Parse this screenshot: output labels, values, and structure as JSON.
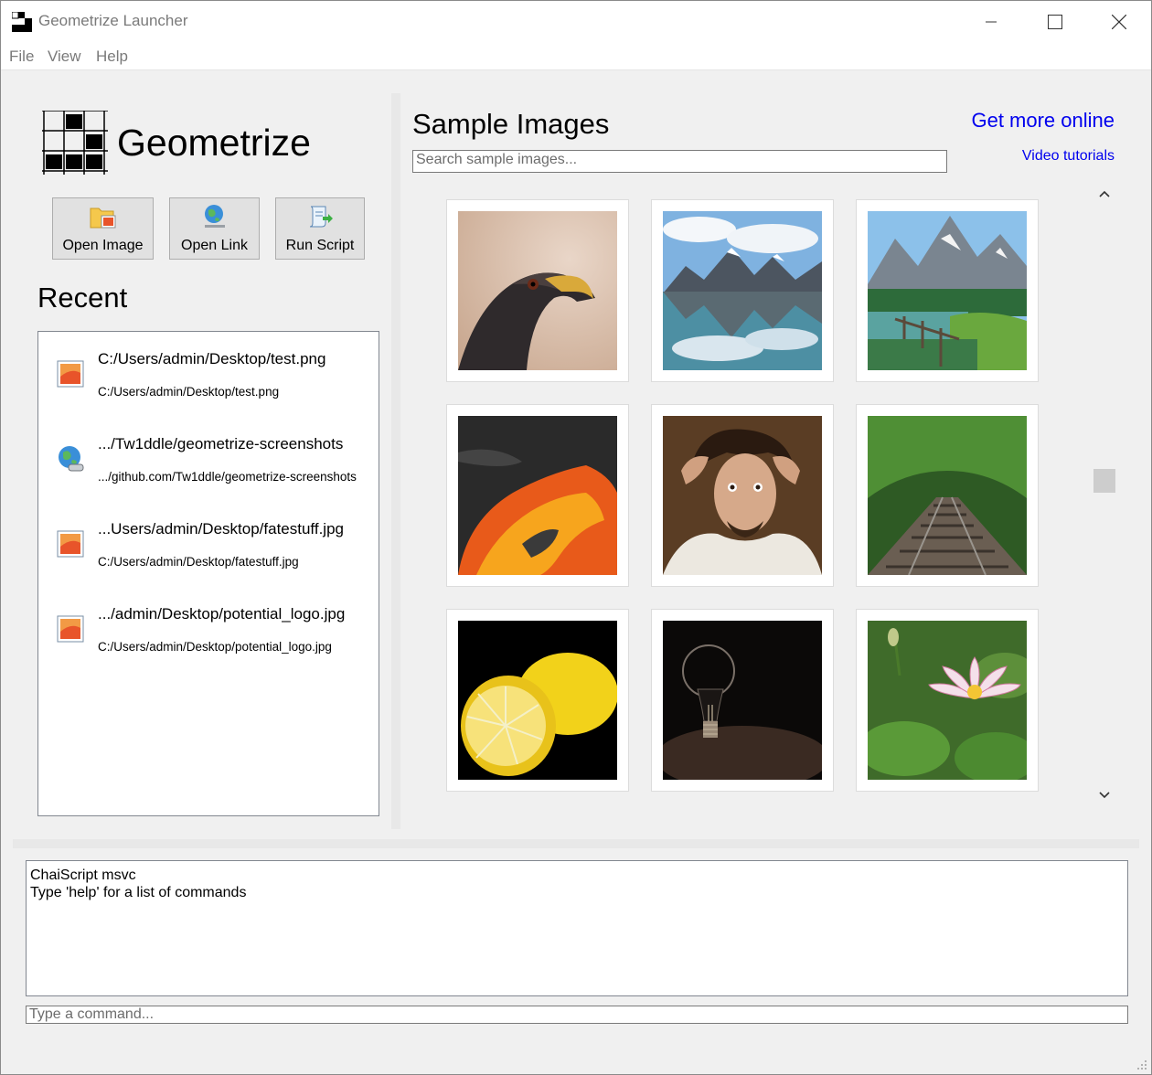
{
  "window": {
    "title": "Geometrize Launcher"
  },
  "menu": {
    "items": [
      "File",
      "View",
      "Help"
    ]
  },
  "brand": {
    "name": "Geometrize"
  },
  "actions": {
    "open_image": "Open Image",
    "open_link": "Open Link",
    "run_script": "Run Script"
  },
  "recent": {
    "title": "Recent",
    "items": [
      {
        "name": "C:/Users/admin/Desktop/test.png",
        "path": "C:/Users/admin/Desktop/test.png",
        "icon": "image-file-icon"
      },
      {
        "name": ".../Tw1ddle/geometrize-screenshots",
        "path": ".../github.com/Tw1ddle/geometrize-screenshots",
        "icon": "globe-link-icon"
      },
      {
        "name": "...Users/admin/Desktop/fatestuff.jpg",
        "path": "C:/Users/admin/Desktop/fatestuff.jpg",
        "icon": "image-file-icon"
      },
      {
        "name": ".../admin/Desktop/potential_logo.jpg",
        "path": "C:/Users/admin/Desktop/potential_logo.jpg",
        "icon": "image-file-icon"
      }
    ]
  },
  "samples": {
    "title": "Sample Images",
    "search_placeholder": "Search sample images...",
    "more_link": "Get more online",
    "video_link": "Video tutorials",
    "thumbnails": [
      "hawk",
      "mountain lake",
      "alpine meadow lake",
      "lava flow",
      "portrait of man",
      "railway tracks",
      "lemon",
      "light bulb",
      "lotus flower"
    ]
  },
  "console": {
    "lines": [
      "ChaiScript msvc",
      "Type 'help' for a list of commands"
    ],
    "command_placeholder": "Type a command..."
  }
}
